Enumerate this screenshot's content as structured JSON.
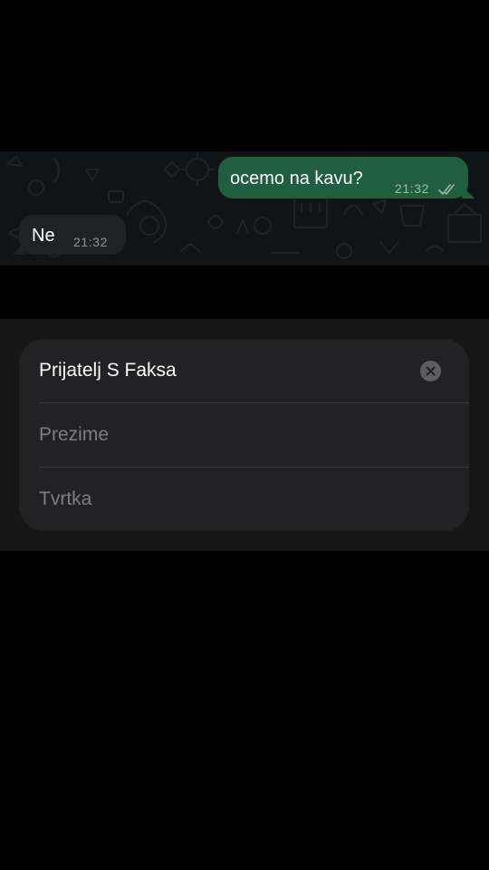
{
  "chat": {
    "messages": [
      {
        "direction": "outgoing",
        "text": "ocemo na kavu?",
        "time": "21:32",
        "status_icon": "double-check-icon"
      },
      {
        "direction": "incoming",
        "text": "Ne",
        "time": "21:32"
      }
    ]
  },
  "contact_form": {
    "first_name": {
      "value": "Prijatelj S Faksa",
      "clear_icon": "clear-circle-icon"
    },
    "last_name": {
      "value": "",
      "placeholder": "Prezime"
    },
    "company": {
      "value": "",
      "placeholder": "Tvrtka"
    }
  },
  "colors": {
    "background": "#000000",
    "chat_background": "#111417",
    "outgoing_bubble": "#1f5e3f",
    "incoming_bubble": "#1f2225",
    "sheet_background": "#161617",
    "card_background": "#222224",
    "placeholder_text": "#7d7d82"
  }
}
